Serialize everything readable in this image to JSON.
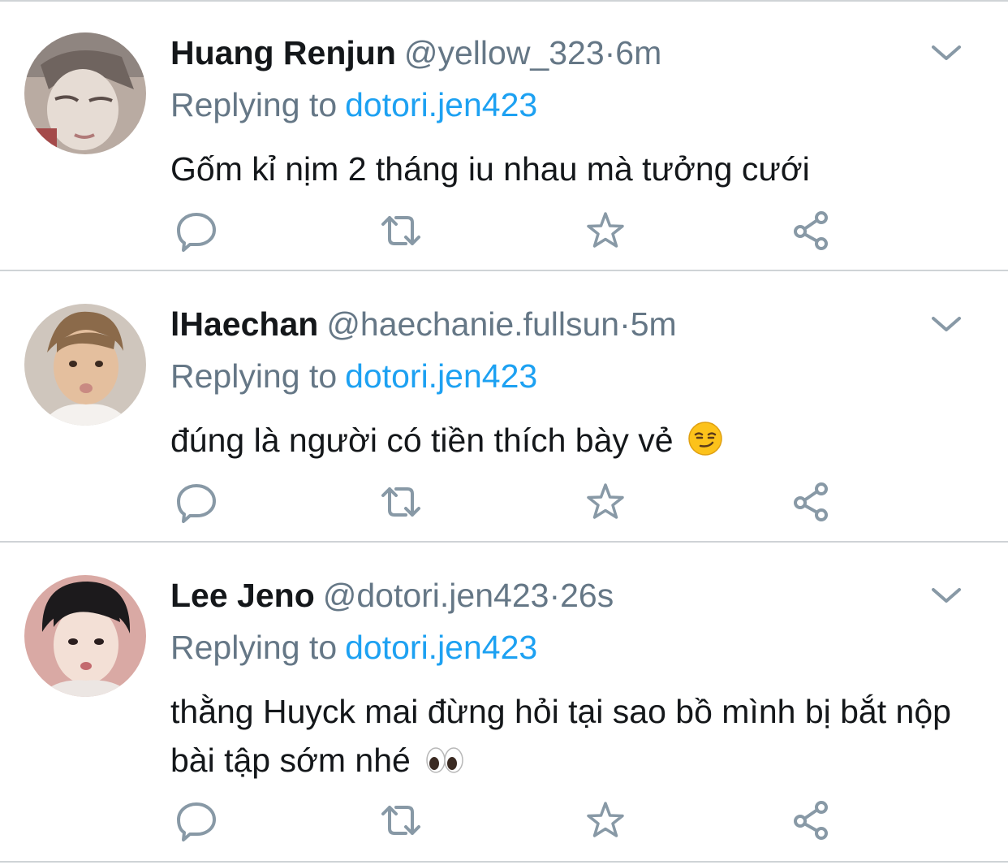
{
  "colors": {
    "name": "#14171a",
    "muted": "#657786",
    "link": "#1da1f2",
    "divider": "#cfd3d6",
    "icon": "#8899a6"
  },
  "tweets": [
    {
      "display_name": "Huang Renjun",
      "handle": "@yellow_323",
      "separator": "·",
      "time": "6m",
      "replying_label": "Replying to",
      "replying_to": "dotori.jen423",
      "text": "Gốm kỉ nịm 2 tháng iu nhau mà tưởng cưới",
      "emoji": ""
    },
    {
      "display_name": "lHaechan",
      "handle": "@haechanie.fullsun",
      "separator": "·",
      "time": "5m",
      "replying_label": "Replying to",
      "replying_to": "dotori.jen423",
      "text": "đúng là người có tiền thích bày vẻ",
      "emoji": "😏"
    },
    {
      "display_name": "Lee Jeno",
      "handle": "@dotori.jen423",
      "separator": "·",
      "time": "26s",
      "replying_label": "Replying to",
      "replying_to": "dotori.jen423",
      "text": "thằng Huyck mai đừng hỏi tại sao bồ mình bị bắt nộp bài tập sớm nhé",
      "emoji": "👀"
    }
  ],
  "icons": {
    "reply": "reply-icon",
    "retweet": "retweet-icon",
    "like": "star-icon",
    "share": "share-icon",
    "more": "chevron-down-icon"
  }
}
